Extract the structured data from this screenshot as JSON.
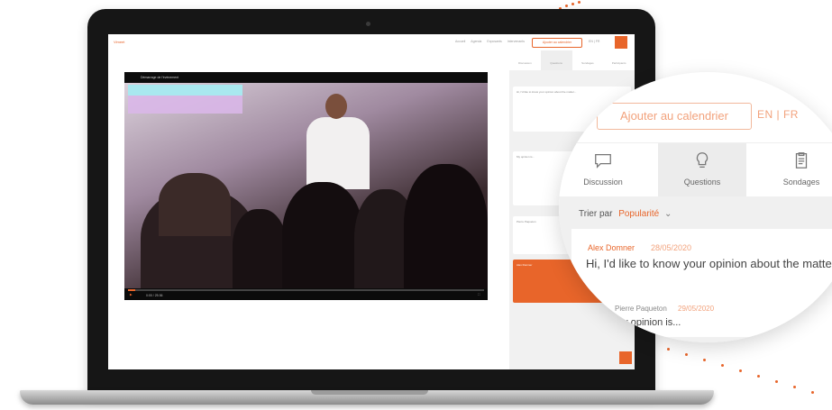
{
  "colors": {
    "accent": "#e8652a",
    "accent_light": "#f2a27c",
    "panel_bg": "#f0f0f0"
  },
  "app": {
    "brand": "Vimeet",
    "nav": [
      "Accueil",
      "Agenda",
      "Exposants",
      "Intervenants"
    ],
    "calendar_button_small": "Ajouter au calendrier",
    "lang_small": "EN | FR"
  },
  "video": {
    "title": "Démarrage de l'événement",
    "time": "0:00 / 25:36",
    "progress": 0.02
  },
  "side_panel": {
    "tabs": [
      "Discussion",
      "Questions",
      "Sondages",
      "Participants"
    ],
    "cards": [
      {
        "text": "Hi, I'd like to know your opinion about the matter..."
      },
      {
        "text": "My opinion is..."
      },
      {
        "text": "Pierre Paqueton"
      },
      {
        "text": "Alex Domner"
      }
    ]
  },
  "magnifier": {
    "calendar_button": "Ajouter au calendrier",
    "lang": "EN | FR",
    "tabs": [
      {
        "label": "Discussion",
        "icon": "chat-bubble-icon"
      },
      {
        "label": "Questions",
        "icon": "lightbulb-icon"
      },
      {
        "label": "Sondages",
        "icon": "clipboard-icon"
      }
    ],
    "sort_label": "Trier par",
    "sort_value": "Popularité",
    "question": {
      "author": "Alex Domner",
      "date": "28/05/2020",
      "text": "Hi, I'd like to know your opinion about the matter..."
    },
    "reply": {
      "author": "Pierre Paqueton",
      "date": "29/05/2020",
      "text": "My opinion is..."
    }
  }
}
